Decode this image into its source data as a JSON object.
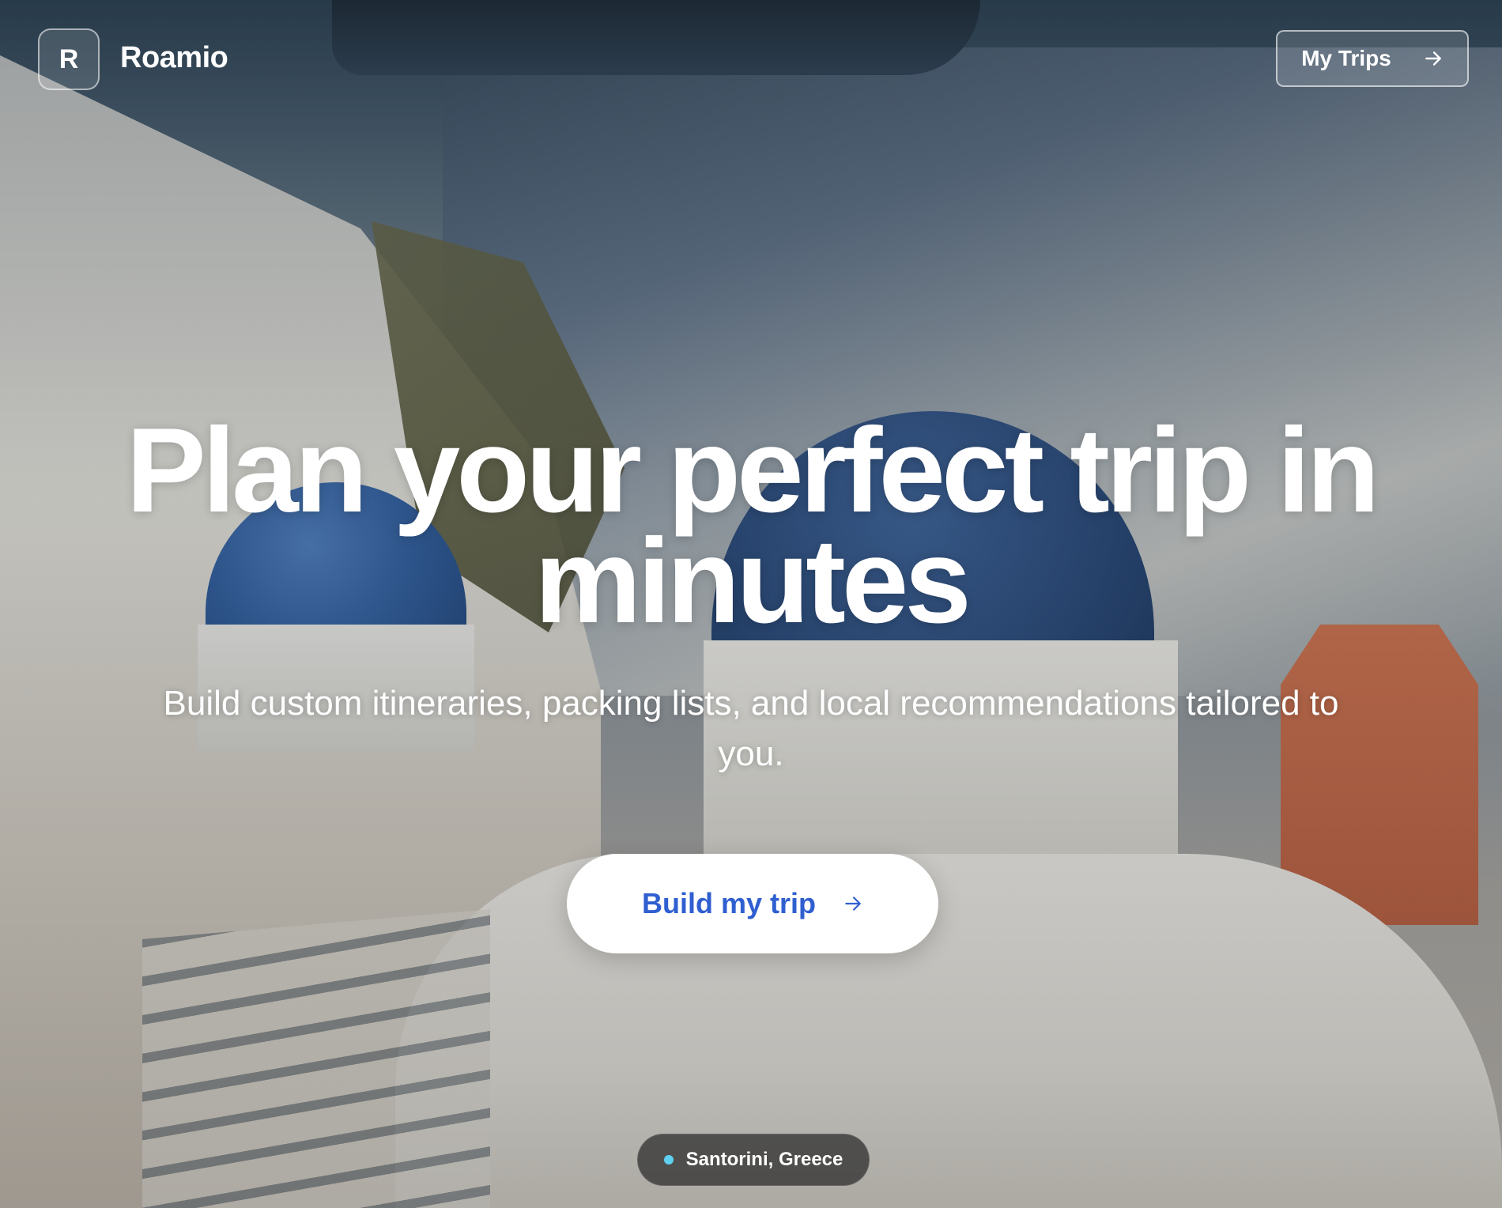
{
  "header": {
    "logo_letter": "R",
    "brand": "Roamio",
    "my_trips_label": "My Trips"
  },
  "hero": {
    "title": "Plan your perfect trip in minutes",
    "subtitle": "Build custom itineraries, packing lists, and local recommendations tailored to you.",
    "cta_label": "Build my trip"
  },
  "location": {
    "label": "Santorini, Greece"
  },
  "icons": {
    "my_trips": "arrow-right-icon",
    "cta": "arrow-right-icon",
    "location": "dot-icon"
  },
  "colors": {
    "cta_text": "#2f5fd0",
    "location_dot": "#5fd0f0"
  }
}
